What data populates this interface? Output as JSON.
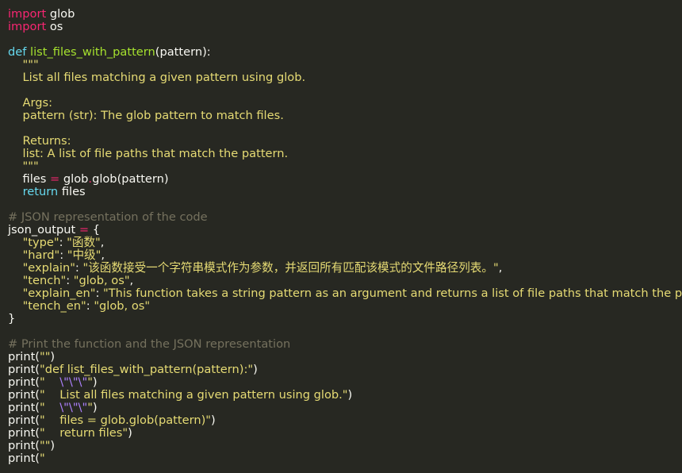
{
  "editor": {
    "theme_colors": {
      "background": "#272822",
      "keyword": "#f92672",
      "builtin": "#66d9ef",
      "function": "#a6e22e",
      "string": "#e6db74",
      "comment": "#75715e",
      "escape": "#ae81ff",
      "text": "#f8f8f2"
    },
    "lines": [
      [
        {
          "t": "import",
          "c": "kw"
        },
        {
          "t": " glob",
          "c": "plain"
        }
      ],
      [
        {
          "t": "import",
          "c": "kw"
        },
        {
          "t": " os",
          "c": "plain"
        }
      ],
      [],
      [
        {
          "t": "def",
          "c": "kw-blue"
        },
        {
          "t": " ",
          "c": "plain"
        },
        {
          "t": "list_files_with_pattern",
          "c": "fn"
        },
        {
          "t": "(pattern):",
          "c": "plain"
        }
      ],
      [
        {
          "t": "    \"\"\"",
          "c": "str"
        }
      ],
      [
        {
          "t": "    List all files matching a given pattern using glob.",
          "c": "str"
        }
      ],
      [],
      [
        {
          "t": "    Args:",
          "c": "str"
        }
      ],
      [
        {
          "t": "    pattern (str): The glob pattern to match files.",
          "c": "str"
        }
      ],
      [],
      [
        {
          "t": "    Returns:",
          "c": "str"
        }
      ],
      [
        {
          "t": "    list: A list of file paths that match the pattern.",
          "c": "str"
        }
      ],
      [
        {
          "t": "    \"\"\"",
          "c": "str"
        }
      ],
      [
        {
          "t": "    files ",
          "c": "plain"
        },
        {
          "t": "=",
          "c": "op"
        },
        {
          "t": " glob",
          "c": "plain"
        },
        {
          "t": ".",
          "c": "op"
        },
        {
          "t": "glob(pattern)",
          "c": "plain"
        }
      ],
      [
        {
          "t": "    ",
          "c": "plain"
        },
        {
          "t": "return",
          "c": "kw-blue"
        },
        {
          "t": " files",
          "c": "plain"
        }
      ],
      [],
      [
        {
          "t": "# JSON representation of the code",
          "c": "cm"
        }
      ],
      [
        {
          "t": "json_output ",
          "c": "plain"
        },
        {
          "t": "=",
          "c": "op"
        },
        {
          "t": " {",
          "c": "plain"
        }
      ],
      [
        {
          "t": "    ",
          "c": "plain"
        },
        {
          "t": "\"type\"",
          "c": "str"
        },
        {
          "t": ": ",
          "c": "plain"
        },
        {
          "t": "\"函数\"",
          "c": "str"
        },
        {
          "t": ",",
          "c": "plain"
        }
      ],
      [
        {
          "t": "    ",
          "c": "plain"
        },
        {
          "t": "\"hard\"",
          "c": "str"
        },
        {
          "t": ": ",
          "c": "plain"
        },
        {
          "t": "\"中级\"",
          "c": "str"
        },
        {
          "t": ",",
          "c": "plain"
        }
      ],
      [
        {
          "t": "    ",
          "c": "plain"
        },
        {
          "t": "\"explain\"",
          "c": "str"
        },
        {
          "t": ": ",
          "c": "plain"
        },
        {
          "t": "\"该函数接受一个字符串模式作为参数，并返回所有匹配该模式的文件路径列表。\"",
          "c": "str"
        },
        {
          "t": ",",
          "c": "plain"
        }
      ],
      [
        {
          "t": "    ",
          "c": "plain"
        },
        {
          "t": "\"tench\"",
          "c": "str"
        },
        {
          "t": ": ",
          "c": "plain"
        },
        {
          "t": "\"glob, os\"",
          "c": "str"
        },
        {
          "t": ",",
          "c": "plain"
        }
      ],
      [
        {
          "t": "    ",
          "c": "plain"
        },
        {
          "t": "\"explain_en\"",
          "c": "str"
        },
        {
          "t": ": ",
          "c": "plain"
        },
        {
          "t": "\"This function takes a string pattern as an argument and returns a list of file paths that match the pattern.\"",
          "c": "str"
        },
        {
          "t": ",",
          "c": "plain"
        }
      ],
      [
        {
          "t": "    ",
          "c": "plain"
        },
        {
          "t": "\"tench_en\"",
          "c": "str"
        },
        {
          "t": ": ",
          "c": "plain"
        },
        {
          "t": "\"glob, os\"",
          "c": "str"
        }
      ],
      [
        {
          "t": "}",
          "c": "plain"
        }
      ],
      [],
      [
        {
          "t": "# Print the function and the JSON representation",
          "c": "cm"
        }
      ],
      [
        {
          "t": "print(",
          "c": "plain"
        },
        {
          "t": "\"\"",
          "c": "str"
        },
        {
          "t": ")",
          "c": "plain"
        }
      ],
      [
        {
          "t": "print(",
          "c": "plain"
        },
        {
          "t": "\"def list_files_with_pattern(pattern):\"",
          "c": "str"
        },
        {
          "t": ")",
          "c": "plain"
        }
      ],
      [
        {
          "t": "print(",
          "c": "plain"
        },
        {
          "t": "\"    ",
          "c": "str"
        },
        {
          "t": "\\\"",
          "c": "esc"
        },
        {
          "t": "\\\"",
          "c": "esc"
        },
        {
          "t": "\\\"",
          "c": "esc"
        },
        {
          "t": "\"",
          "c": "str"
        },
        {
          "t": ")",
          "c": "plain"
        }
      ],
      [
        {
          "t": "print(",
          "c": "plain"
        },
        {
          "t": "\"    List all files matching a given pattern using glob.\"",
          "c": "str"
        },
        {
          "t": ")",
          "c": "plain"
        }
      ],
      [
        {
          "t": "print(",
          "c": "plain"
        },
        {
          "t": "\"    ",
          "c": "str"
        },
        {
          "t": "\\\"",
          "c": "esc"
        },
        {
          "t": "\\\"",
          "c": "esc"
        },
        {
          "t": "\\\"",
          "c": "esc"
        },
        {
          "t": "\"",
          "c": "str"
        },
        {
          "t": ")",
          "c": "plain"
        }
      ],
      [
        {
          "t": "print(",
          "c": "plain"
        },
        {
          "t": "\"    files = glob.glob(pattern)\"",
          "c": "str"
        },
        {
          "t": ")",
          "c": "plain"
        }
      ],
      [
        {
          "t": "print(",
          "c": "plain"
        },
        {
          "t": "\"    return files\"",
          "c": "str"
        },
        {
          "t": ")",
          "c": "plain"
        }
      ],
      [
        {
          "t": "print(",
          "c": "plain"
        },
        {
          "t": "\"\"",
          "c": "str"
        },
        {
          "t": ")",
          "c": "plain"
        }
      ],
      [
        {
          "t": "print(",
          "c": "plain"
        },
        {
          "t": "\"",
          "c": "str"
        }
      ]
    ]
  }
}
